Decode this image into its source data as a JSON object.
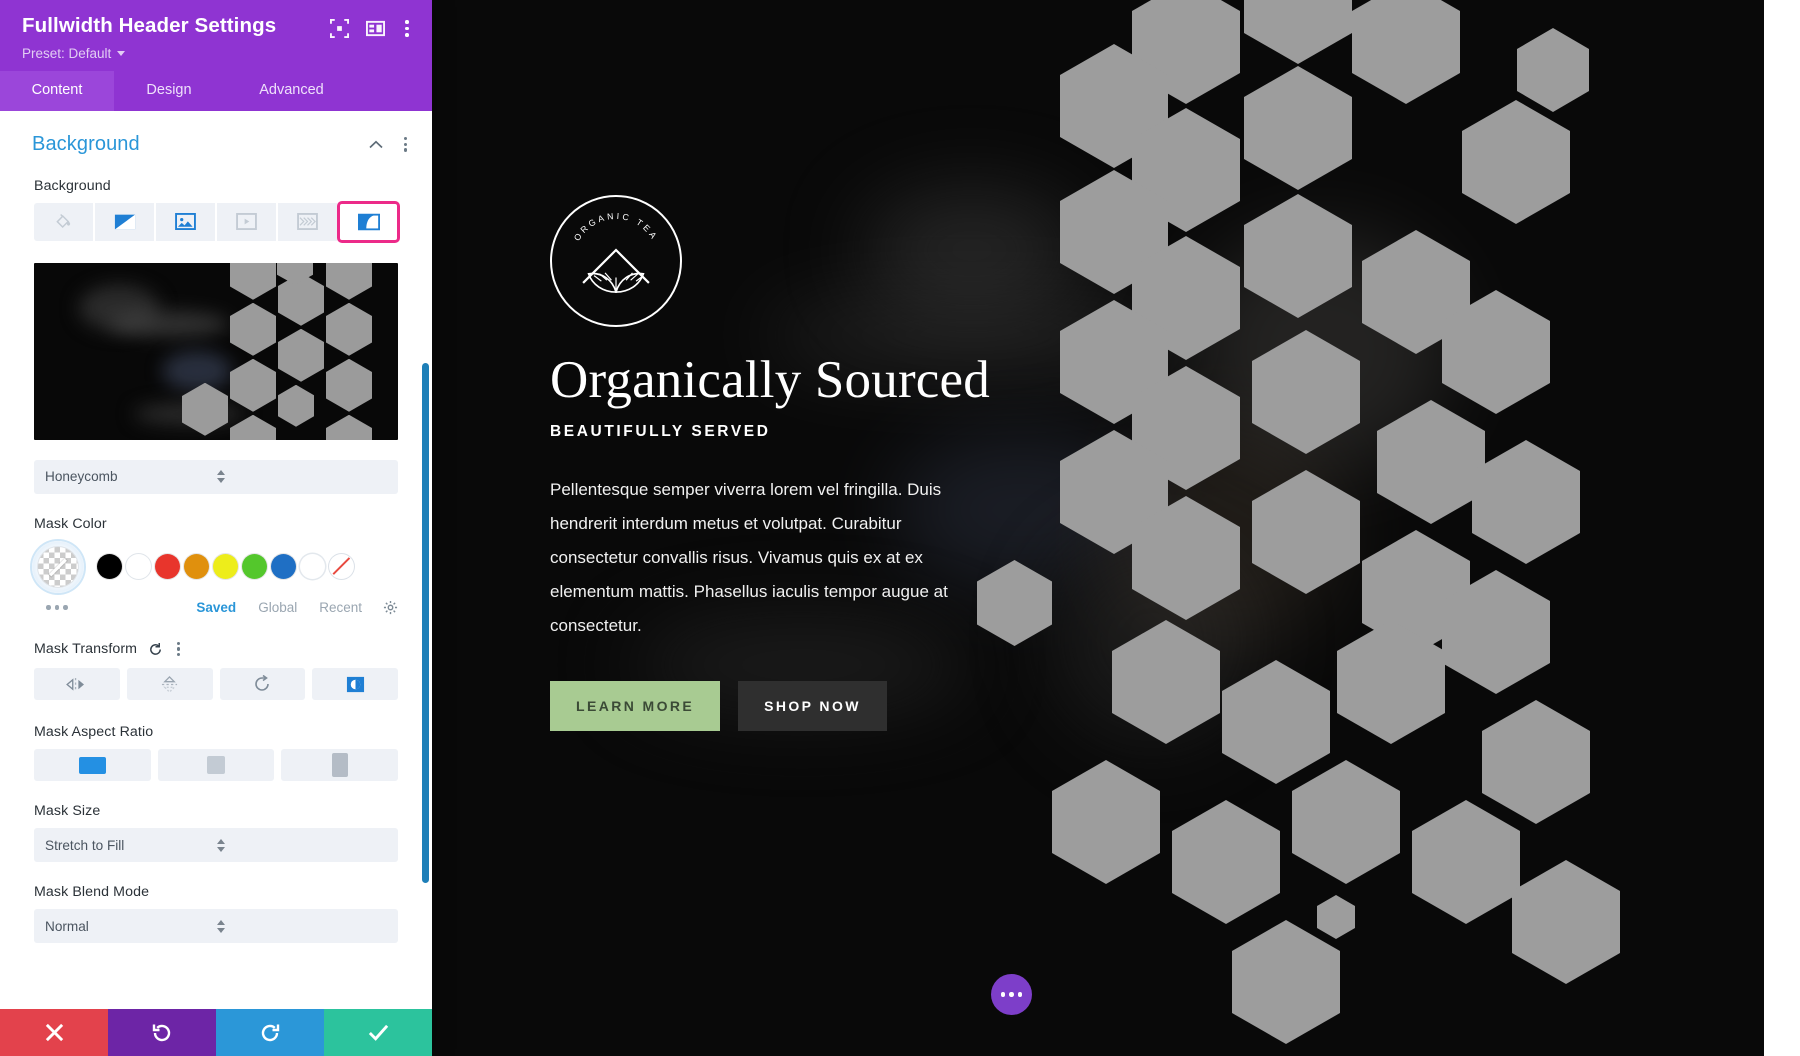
{
  "panel": {
    "title": "Fullwidth Header Settings",
    "preset_label": "Preset: Default",
    "header_icons": [
      {
        "name": "focus-icon"
      },
      {
        "name": "layout-icon"
      },
      {
        "name": "kebab-menu-icon"
      }
    ],
    "tabs": [
      {
        "label": "Content",
        "active": true
      },
      {
        "label": "Design",
        "active": false
      },
      {
        "label": "Advanced",
        "active": false
      }
    ],
    "section": {
      "title": "Background",
      "collapse_icon": "chevron-up-icon",
      "options_icon": "kebab-menu-icon"
    },
    "background_field": {
      "label": "Background",
      "types": [
        {
          "name": "background-color",
          "icon": "paint-bucket-icon",
          "state": "inactive",
          "selected": false
        },
        {
          "name": "background-gradient",
          "icon": "gradient-icon",
          "state": "active",
          "selected": false
        },
        {
          "name": "background-image",
          "icon": "image-icon",
          "state": "active",
          "selected": false
        },
        {
          "name": "background-video",
          "icon": "video-icon",
          "state": "inactive",
          "selected": false
        },
        {
          "name": "background-pattern",
          "icon": "pattern-icon",
          "state": "inactive",
          "selected": false
        },
        {
          "name": "background-mask",
          "icon": "mask-icon",
          "state": "active",
          "selected": true
        }
      ]
    },
    "mask_style": {
      "label": "",
      "value": "Honeycomb"
    },
    "mask_color": {
      "label": "Mask Color",
      "selected_swatch": "transparent",
      "swatches": [
        {
          "name": "black",
          "hex": "#000000"
        },
        {
          "name": "white",
          "hex": "#ffffff"
        },
        {
          "name": "red",
          "hex": "#e8352c"
        },
        {
          "name": "orange",
          "hex": "#e0900d"
        },
        {
          "name": "yellow",
          "hex": "#eded1b"
        },
        {
          "name": "green",
          "hex": "#54c72c"
        },
        {
          "name": "blue",
          "hex": "#1f6fc4"
        },
        {
          "name": "white-2",
          "hex": "#ffffff"
        },
        {
          "name": "none",
          "hex": "none"
        }
      ],
      "tabs": [
        {
          "label": "Saved",
          "active": true
        },
        {
          "label": "Global",
          "active": false
        },
        {
          "label": "Recent",
          "active": false
        }
      ],
      "more_icon": "more-dots-icon",
      "settings_icon": "gear-icon"
    },
    "mask_transform": {
      "label": "Mask Transform",
      "reset_icon": "reset-icon",
      "options_icon": "kebab-menu-icon",
      "buttons": [
        {
          "name": "flip-horizontal",
          "active": false
        },
        {
          "name": "flip-vertical",
          "active": false
        },
        {
          "name": "rotate",
          "active": false
        },
        {
          "name": "invert",
          "active": true
        }
      ]
    },
    "mask_aspect_ratio": {
      "label": "Mask Aspect Ratio",
      "options": [
        {
          "name": "landscape",
          "active": true
        },
        {
          "name": "square",
          "active": false
        },
        {
          "name": "portrait",
          "active": false
        }
      ]
    },
    "mask_size": {
      "label": "Mask Size",
      "value": "Stretch to Fill"
    },
    "mask_blend_mode": {
      "label": "Mask Blend Mode",
      "value": "Normal"
    },
    "footer": [
      {
        "name": "cancel-button",
        "icon": "close-icon",
        "color": "#e3424c"
      },
      {
        "name": "undo-button",
        "icon": "undo-icon",
        "color": "#6d25a6"
      },
      {
        "name": "redo-button",
        "icon": "redo-icon",
        "color": "#2b97d8"
      },
      {
        "name": "save-button",
        "icon": "check-icon",
        "color": "#2cc39d"
      }
    ]
  },
  "hero": {
    "logo_text_top": "ORGANIC TEA",
    "heading": "Organically Sourced",
    "subheading": "BEAUTIFULLY SERVED",
    "paragraph": "Pellentesque semper viverra lorem vel fringilla. Duis hendrerit interdum metus et volutpat. Curabitur consectetur convallis risus. Vivamus quis ex at ex elementum mattis. Phasellus iaculis tempor augue at consectetur.",
    "buttons": [
      {
        "label": "LEARN MORE",
        "style": "primary",
        "color": "#a8cb92"
      },
      {
        "label": "SHOP NOW",
        "style": "secondary",
        "color": "#2f2f2f"
      }
    ],
    "fab_icon": "more-dots-icon"
  },
  "colors": {
    "brand_purple": "#8f34d2",
    "accent_blue": "#2a96d8",
    "highlight_pink": "#ec2a89"
  }
}
